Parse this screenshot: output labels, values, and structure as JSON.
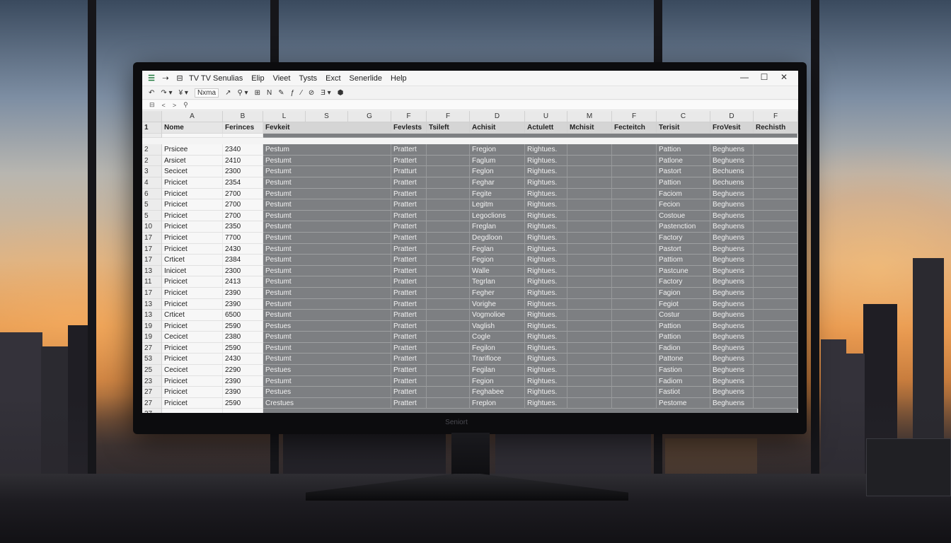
{
  "app": {
    "menu": [
      "TV TV Senulias",
      "Elip",
      "Vieet",
      "Tysts",
      "Exct",
      "Senerlide",
      "Help"
    ],
    "window_controls": [
      "—",
      "☐",
      "✕"
    ]
  },
  "toolbar": {
    "items": [
      "↶",
      "↷ ▾",
      "¥ ▾",
      "Nxma",
      "↗",
      "⚲ ▾",
      "⊞",
      "N",
      "✎",
      "ƒ",
      "⁄",
      "⊘",
      "Ǝ ▾",
      "⬢"
    ]
  },
  "formula_bar": {
    "items": [
      "⊟",
      "<",
      ">",
      "⚲"
    ]
  },
  "columns": [
    "A",
    "B",
    "L",
    "S",
    "G",
    "F",
    "F",
    "D",
    "U",
    "M",
    "F",
    "C",
    "D",
    "F"
  ],
  "header_row": {
    "num": "1",
    "cells": [
      "Nome",
      "Ferinces",
      "Fevkeit",
      "",
      "",
      "Fevlests",
      "Tsileft",
      "Achisit",
      "Actulett",
      "Mchisit",
      "Fecteitch",
      "Terisit",
      "FroVesit",
      "Rechisth"
    ]
  },
  "rows": [
    {
      "num": "2",
      "a": "Prsicee",
      "b": "2340",
      "c": "Pestum",
      "f": "Prattert",
      "h": "Fregion",
      "i": "Rightues.",
      "l": "Pattion",
      "m": "Beghuens"
    },
    {
      "num": "2",
      "a": "Arsicet",
      "b": "2410",
      "c": "Pestumt",
      "f": "Prattert",
      "h": "Faglum",
      "i": "Rightues.",
      "l": "Patlone",
      "m": "Beghuens"
    },
    {
      "num": "3",
      "a": "Secicet",
      "b": "2300",
      "c": "Pestumt",
      "f": "Pratturt",
      "h": "Feglon",
      "i": "Rightues.",
      "l": "Pastort",
      "m": "Bechuens"
    },
    {
      "num": "4",
      "a": "Pricicet",
      "b": "2354",
      "c": "Pestumt",
      "f": "Prattert",
      "h": "Feghar",
      "i": "Rightues.",
      "l": "Pattion",
      "m": "Bechuens"
    },
    {
      "num": "6",
      "a": "Pricicet",
      "b": "2700",
      "c": "Pestumt",
      "f": "Prattert",
      "h": "Fegite",
      "i": "Rightues.",
      "l": "Faciom",
      "m": "Beghuens"
    },
    {
      "num": "5",
      "a": "Pricicet",
      "b": "2700",
      "c": "Pestumt",
      "f": "Prattert",
      "h": "Legitm",
      "i": "Rightues.",
      "l": "Fecion",
      "m": "Beghuens"
    },
    {
      "num": "5",
      "a": "Pricicet",
      "b": "2700",
      "c": "Pestumt",
      "f": "Prattert",
      "h": "Legoclions",
      "i": "Rightues.",
      "l": "Costoue",
      "m": "Beghuens"
    },
    {
      "num": "10",
      "a": "Pricicet",
      "b": "2350",
      "c": "Pestumt",
      "f": "Prattert",
      "h": "Freglan",
      "i": "Rightues.",
      "l": "Pastenction",
      "m": "Beghuens"
    },
    {
      "num": "17",
      "a": "Pricicet",
      "b": "7700",
      "c": "Pestumt",
      "f": "Prattert",
      "h": "Degdloon",
      "i": "Rightues.",
      "l": "Factory",
      "m": "Beghuens"
    },
    {
      "num": "17",
      "a": "Pricicet",
      "b": "2430",
      "c": "Pestumt",
      "f": "Prattert",
      "h": "Feglan",
      "i": "Rightues.",
      "l": "Pastort",
      "m": "Beghuens"
    },
    {
      "num": "17",
      "a": "Crticet",
      "b": "2384",
      "c": "Pestumt",
      "f": "Prattert",
      "h": "Fegion",
      "i": "Rightues.",
      "l": "Pattiom",
      "m": "Beghuens"
    },
    {
      "num": "13",
      "a": "Inicicet",
      "b": "2300",
      "c": "Pestumt",
      "f": "Prattert",
      "h": "Walle",
      "i": "Rightues.",
      "l": "Pastcune",
      "m": "Beghuens"
    },
    {
      "num": "11",
      "a": "Pricicet",
      "b": "2413",
      "c": "Pestumt",
      "f": "Prattert",
      "h": "Tegrlan",
      "i": "Rightues.",
      "l": "Factory",
      "m": "Beghuens"
    },
    {
      "num": "17",
      "a": "Pricicet",
      "b": "2390",
      "c": "Pestumt",
      "f": "Prattert",
      "h": "Fegher",
      "i": "Rightues.",
      "l": "Fagion",
      "m": "Beghuens"
    },
    {
      "num": "13",
      "a": "Pricicet",
      "b": "2390",
      "c": "Pestumt",
      "f": "Prattert",
      "h": "Vorighe",
      "i": "Rightues.",
      "l": "Fegiot",
      "m": "Beghuens"
    },
    {
      "num": "13",
      "a": "Crticet",
      "b": "6500",
      "c": "Pestumt",
      "f": "Prattert",
      "h": "Vogmolioe",
      "i": "Rightues.",
      "l": "Costur",
      "m": "Beghuens"
    },
    {
      "num": "19",
      "a": "Pricicet",
      "b": "2590",
      "c": "Pestues",
      "f": "Prattert",
      "h": "Vaglish",
      "i": "Rightues.",
      "l": "Pattion",
      "m": "Beghuens"
    },
    {
      "num": "19",
      "a": "Cecicet",
      "b": "2380",
      "c": "Pestumt",
      "f": "Prattert",
      "h": "Cogle",
      "i": "Rightues.",
      "l": "Pattion",
      "m": "Beghuens"
    },
    {
      "num": "27",
      "a": "Pricicet",
      "b": "2590",
      "c": "Pestumt",
      "f": "Prattert",
      "h": "Fegilon",
      "i": "Rightues.",
      "l": "Fadion",
      "m": "Beghuens"
    },
    {
      "num": "53",
      "a": "Pricicet",
      "b": "2430",
      "c": "Pestumt",
      "f": "Prattert",
      "h": "Trarifloce",
      "i": "Rightues.",
      "l": "Pattone",
      "m": "Beghuens"
    },
    {
      "num": "25",
      "a": "Cecicet",
      "b": "2290",
      "c": "Pestues",
      "f": "Prattert",
      "h": "Fegilan",
      "i": "Rightues.",
      "l": "Fastion",
      "m": "Beghuens"
    },
    {
      "num": "23",
      "a": "Pricicet",
      "b": "2390",
      "c": "Pestumt",
      "f": "Prattert",
      "h": "Fegion",
      "i": "Rightues.",
      "l": "Fadiom",
      "m": "Beghuens"
    },
    {
      "num": "27",
      "a": "Pricicet",
      "b": "2390",
      "c": "Pestues",
      "f": "Prattert",
      "h": "Feghabee",
      "i": "Rightues.",
      "l": "Fastiot",
      "m": "Beghuens"
    },
    {
      "num": "27",
      "a": "Pricicet",
      "b": "2590",
      "c": "Crestues",
      "f": "Prattert",
      "h": "Freplon",
      "i": "Rightues.",
      "l": "Pestome",
      "m": "Beghuens"
    }
  ],
  "last_row_num": "27",
  "monitor_brand": "Seniort",
  "colors": {
    "accent": "#2f8f4e",
    "cell_dark": "#7d7f82",
    "sunset": "#e39a52"
  }
}
